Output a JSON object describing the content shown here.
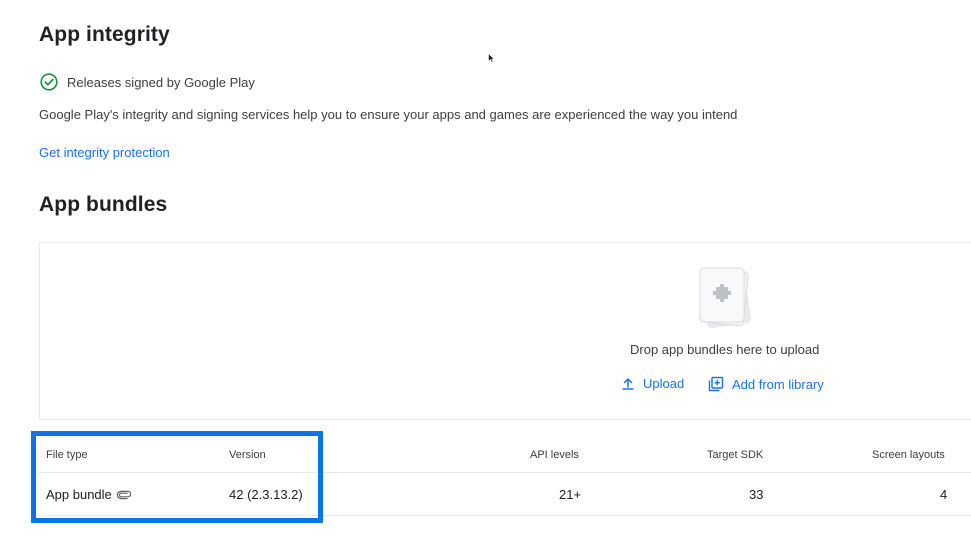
{
  "integrity": {
    "title": "App integrity",
    "status_text": "Releases signed by Google Play",
    "description": "Google Play's integrity and signing services help you to ensure your apps and games are experienced the way you intend",
    "link_label": "Get integrity protection"
  },
  "bundles": {
    "title": "App bundles",
    "drop_text": "Drop app bundles here to upload",
    "upload_label": "Upload",
    "library_label": "Add from library",
    "columns": {
      "file_type": "File type",
      "version": "Version",
      "api_levels": "API levels",
      "target_sdk": "Target SDK",
      "screen_layouts": "Screen layouts"
    },
    "row": {
      "file_type": "App bundle",
      "version": "42 (2.3.13.2)",
      "api_levels": "21+",
      "target_sdk": "33",
      "screen_layouts": "4"
    }
  },
  "colors": {
    "accent": "#1a73e8",
    "success": "#1e8e3e",
    "highlight": "#0b74ea"
  },
  "icons": [
    "check-circle-icon",
    "upload-icon",
    "add-library-icon",
    "attachment-icon",
    "app-bundle-illustration"
  ]
}
